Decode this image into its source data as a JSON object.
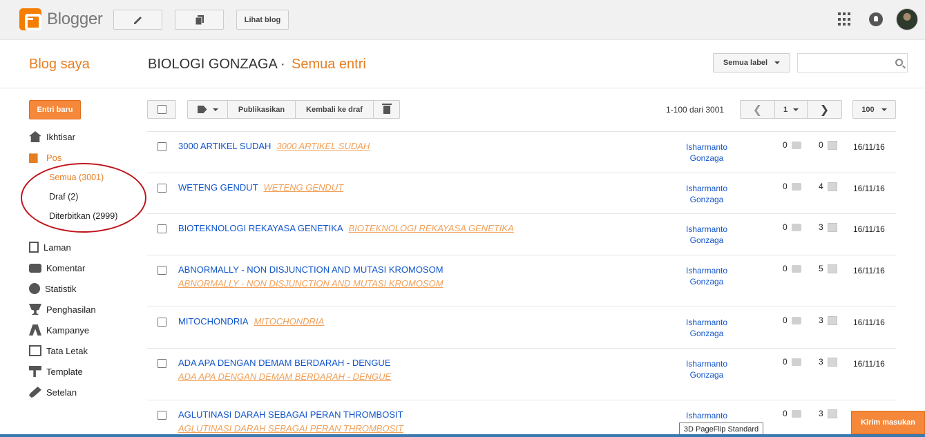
{
  "app": {
    "logo_text": "Blogger"
  },
  "topbar": {
    "view_blog_label": "Lihat blog"
  },
  "header": {
    "my_blogs": "Blog saya",
    "blog_name": "BIOLOGI GONZAGA",
    "separator": "·",
    "section": "Semua entri",
    "label_filter": "Semua label",
    "search": {
      "value": "",
      "placeholder": ""
    }
  },
  "sidebar": {
    "new_post": "Entri baru",
    "items": [
      {
        "label": "Ikhtisar",
        "icon": "home-icon"
      },
      {
        "label": "Pos",
        "icon": "posts-icon"
      },
      {
        "label": "Laman",
        "icon": "pages-icon"
      },
      {
        "label": "Komentar",
        "icon": "comment-icon"
      },
      {
        "label": "Statistik",
        "icon": "pie-chart-icon"
      },
      {
        "label": "Penghasilan",
        "icon": "trophy-icon"
      },
      {
        "label": "Kampanye",
        "icon": "campaign-icon"
      },
      {
        "label": "Tata Letak",
        "icon": "layout-icon"
      },
      {
        "label": "Template",
        "icon": "template-icon"
      },
      {
        "label": "Setelan",
        "icon": "wrench-icon"
      }
    ],
    "sub_items": [
      {
        "label": "Semua (3001)"
      },
      {
        "label": "Draf (2)"
      },
      {
        "label": "Diterbitkan (2999)"
      }
    ]
  },
  "toolbar": {
    "publish": "Publikasikan",
    "revert_draft": "Kembali ke draf",
    "count": "1-100 dari 3001",
    "page": "1",
    "per_page": "100"
  },
  "posts": [
    {
      "title": "3000 ARTIKEL SUDAH",
      "preview": "3000 ARTIKEL SUDAH",
      "author1": "Isharmanto",
      "author2": "Gonzaga",
      "comments": "0",
      "views": "0",
      "date": "16/11/16"
    },
    {
      "title": "WETENG GENDUT",
      "preview": "WETENG GENDUT",
      "author1": "Isharmanto",
      "author2": "Gonzaga",
      "comments": "0",
      "views": "4",
      "date": "16/11/16"
    },
    {
      "title": "BIOTEKNOLOGI REKAYASA GENETIKA",
      "preview": "BIOTEKNOLOGI REKAYASA GENETIKA",
      "author1": "Isharmanto",
      "author2": "Gonzaga",
      "comments": "0",
      "views": "3",
      "date": "16/11/16"
    },
    {
      "title": "ABNORMALLY - NON DISJUNCTION AND MUTASI KROMOSOM",
      "preview": "ABNORMALLY - NON DISJUNCTION AND MUTASI KROMOSOM",
      "author1": "Isharmanto",
      "author2": "Gonzaga",
      "comments": "0",
      "views": "5",
      "date": "16/11/16"
    },
    {
      "title": "MITOCHONDRIA",
      "preview": "MITOCHONDRIA",
      "author1": "Isharmanto",
      "author2": "Gonzaga",
      "comments": "0",
      "views": "3",
      "date": "16/11/16"
    },
    {
      "title": "ADA APA DENGAN DEMAM BERDARAH - DENGUE",
      "preview": "ADA APA DENGAN DEMAM BERDARAH - DENGUE",
      "author1": "Isharmanto",
      "author2": "Gonzaga",
      "comments": "0",
      "views": "3",
      "date": "16/11/16"
    },
    {
      "title": "AGLUTINASI DARAH SEBAGAI PERAN THROMBOSIT",
      "preview": "AGLUTINASI DARAH SEBAGAI PERAN THROMBOSIT",
      "author1": "Isharmanto",
      "author2": "",
      "comments": "0",
      "views": "3",
      "date": ""
    }
  ],
  "tooltip": "3D PageFlip Standard",
  "feedback": "Kirim masukan"
}
